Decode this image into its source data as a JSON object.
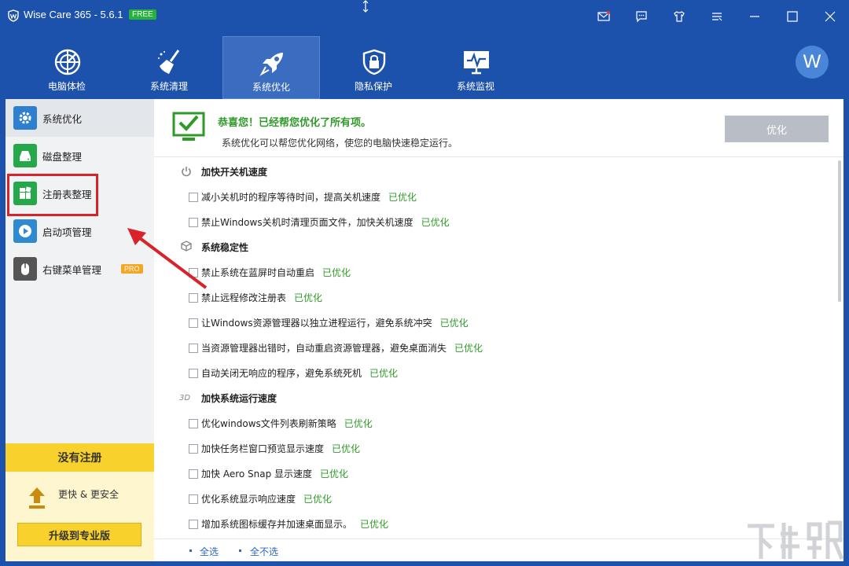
{
  "app": {
    "title": "Wise Care 365 - 5.6.1",
    "badge": "FREE",
    "avatar_letter": "W"
  },
  "nav": [
    {
      "label": "电脑体检",
      "icon": "radar-icon"
    },
    {
      "label": "系统清理",
      "icon": "broom-icon"
    },
    {
      "label": "系统优化",
      "icon": "rocket-icon",
      "active": true
    },
    {
      "label": "隐私保护",
      "icon": "lock-shield-icon"
    },
    {
      "label": "系统监视",
      "icon": "monitor-pulse-icon"
    }
  ],
  "sidebar": {
    "items": [
      {
        "label": "系统优化",
        "icon": "gear-icon",
        "color": "#2f7fd0"
      },
      {
        "label": "磁盘整理",
        "icon": "disk-icon",
        "color": "#25a84a"
      },
      {
        "label": "注册表整理",
        "icon": "registry-icon",
        "color": "#25a84a"
      },
      {
        "label": "启动项管理",
        "icon": "play-icon",
        "color": "#2f8ad0"
      },
      {
        "label": "右键菜单管理",
        "icon": "mouse-icon",
        "color": "#555555",
        "badge": "PRO"
      }
    ],
    "register": {
      "title": "没有注册",
      "subtitle": "更快 & 更安全",
      "upgrade": "升级到专业版"
    }
  },
  "main": {
    "congrats": "恭喜您！已经帮您优化了所有项。",
    "subtitle": "系统优化可以帮您优化网络，使您的电脑快速稳定运行。",
    "optimize_button": "优化",
    "done_label": "已优化",
    "sections": [
      {
        "title": "加快开关机速度",
        "items": [
          "减小关机时的程序等待时间，提高关机速度",
          "禁止Windows关机时清理页面文件，加快关机速度"
        ]
      },
      {
        "title": "系统稳定性",
        "items": [
          "禁止系统在蓝屏时自动重启",
          "禁止远程修改注册表",
          "让Windows资源管理器以独立进程运行，避免系统冲突",
          "当资源管理器出错时，自动重启资源管理器，避免桌面消失",
          "自动关闭无响应的程序，避免系统死机"
        ]
      },
      {
        "title": "加快系统运行速度",
        "items": [
          "优化windows文件列表刷新策略",
          "加快任务栏窗口预览显示速度",
          "加快 Aero Snap 显示速度",
          "优化系统显示响应速度",
          "增加系统图标缓存并加速桌面显示。"
        ]
      }
    ],
    "footer": {
      "select_all": "全选",
      "select_none": "全不选"
    }
  },
  "colors": {
    "titlebar": "#1d52ac",
    "accent_green": "#2f9a29",
    "register_yellow": "#f8d12c",
    "highlight_red": "#d8232a"
  }
}
